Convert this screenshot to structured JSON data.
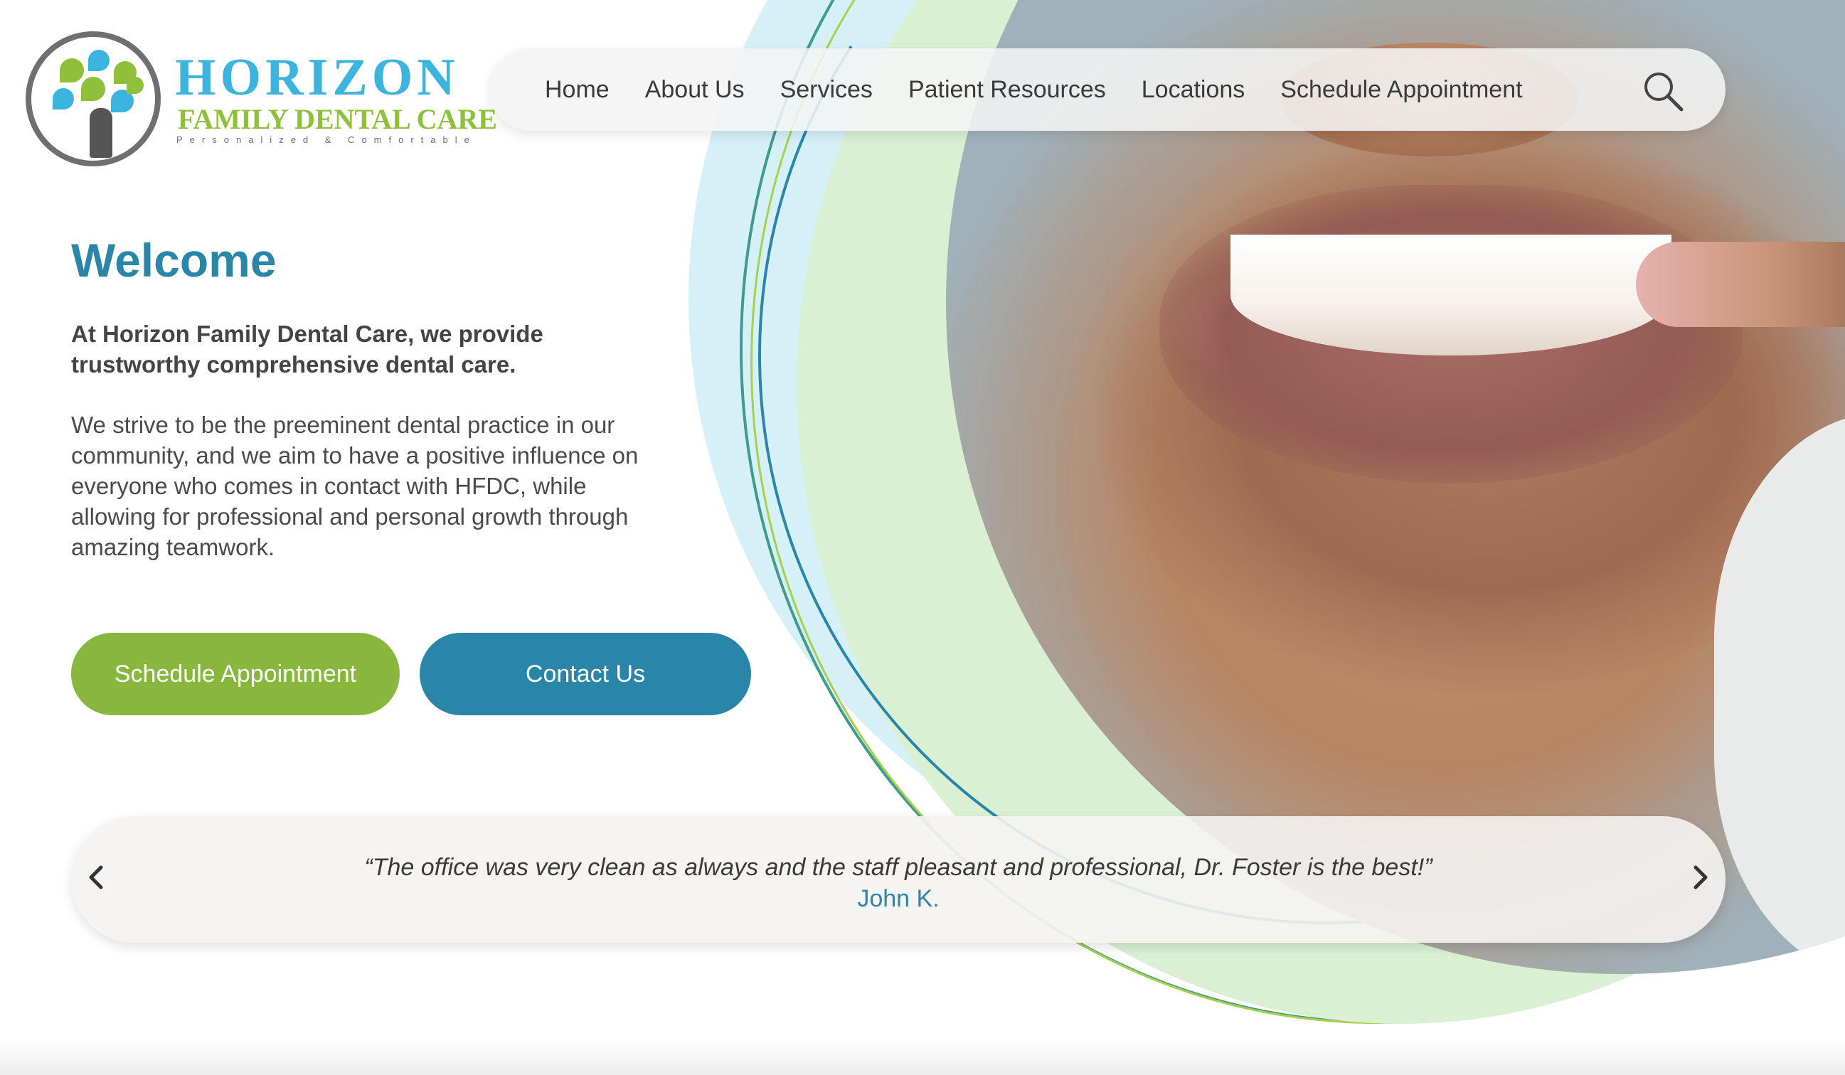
{
  "logo": {
    "name": "HORIZON",
    "subtitle": "FAMILY DENTAL CARE",
    "tagline": "Personalized & Comfortable"
  },
  "nav": {
    "items": [
      {
        "label": "Home"
      },
      {
        "label": "About Us"
      },
      {
        "label": "Services"
      },
      {
        "label": "Patient Resources"
      },
      {
        "label": "Locations"
      },
      {
        "label": "Schedule Appointment"
      }
    ],
    "search_icon": "search-icon"
  },
  "hero": {
    "title": "Welcome",
    "lead": "At Horizon Family Dental Care, we provide trustworthy comprehensive dental care.",
    "body": "We strive to be the preeminent dental practice in our community, and we aim to have a positive influence on everyone who comes in contact with HFDC, while allowing for professional and personal growth through amazing teamwork.",
    "primary_button": "Schedule Appointment",
    "secondary_button": "Contact Us"
  },
  "testimonial": {
    "quote": "“The office was very clean as always and the staff pleasant and professional, Dr. Foster is the best!”",
    "author": "John K.",
    "prev_icon": "chevron-left-icon",
    "next_icon": "chevron-right-icon"
  },
  "colors": {
    "brand_blue": "#2a86a8",
    "brand_green": "#87b73c",
    "logo_blue": "#3bb5df",
    "logo_green": "#8fc03a"
  }
}
